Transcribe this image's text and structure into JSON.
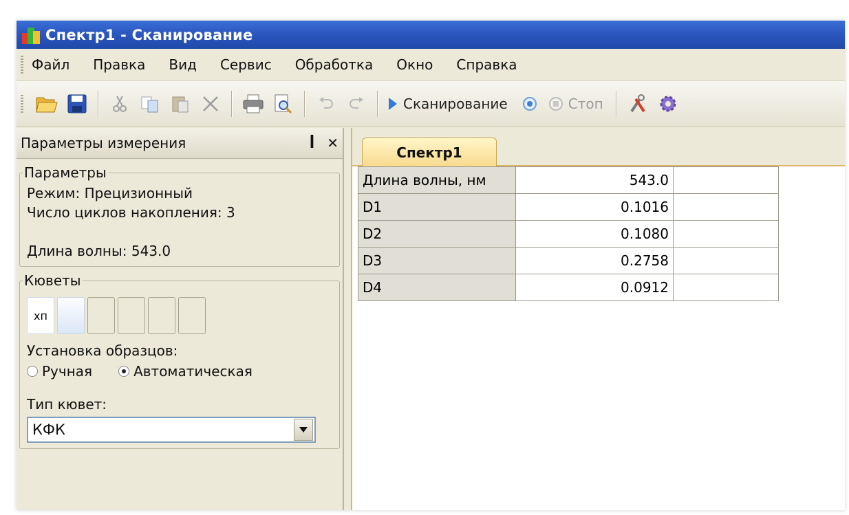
{
  "window": {
    "title": "Спектр1 - Сканирование"
  },
  "menu": [
    "Файл",
    "Правка",
    "Вид",
    "Сервис",
    "Обработка",
    "Окно",
    "Справка"
  ],
  "toolbar": {
    "scan_label": "Сканирование",
    "stop_label": "Стоп",
    "icons": [
      "open-folder-icon",
      "save-icon",
      "cut-icon",
      "copy-icon",
      "paste-icon",
      "delete-icon",
      "print-icon",
      "print-preview-icon",
      "undo-icon",
      "redo-icon",
      "play-icon",
      "record-icon",
      "stop-icon",
      "tools-icon",
      "settings-icon"
    ]
  },
  "panel": {
    "title": "Параметры измерения",
    "params": {
      "legend": "Параметры",
      "mode": "Режим: Прецизионный",
      "cycles": "Число циклов накопления:  3",
      "wavelength": "Длина волны: 543.0"
    },
    "cuvettes": {
      "legend": "Кюветы",
      "first_label": "хп",
      "install_label": "Установка образцов:",
      "manual": "Ручная",
      "auto": "Автоматическая",
      "selected": "auto",
      "type_label": "Тип кювет:",
      "type_value": "КФК"
    }
  },
  "document": {
    "tab": "Спектр1",
    "rows": [
      {
        "label": "Длина волны, нм",
        "value": "543.0"
      },
      {
        "label": "D1",
        "value": "0.1016"
      },
      {
        "label": "D2",
        "value": "0.1080"
      },
      {
        "label": "D3",
        "value": "0.2758"
      },
      {
        "label": "D4",
        "value": "0.0912"
      }
    ]
  },
  "colors": {
    "titlebar": "#2c57c0",
    "tab": "#f8d98d",
    "accent": "#d9b768"
  }
}
